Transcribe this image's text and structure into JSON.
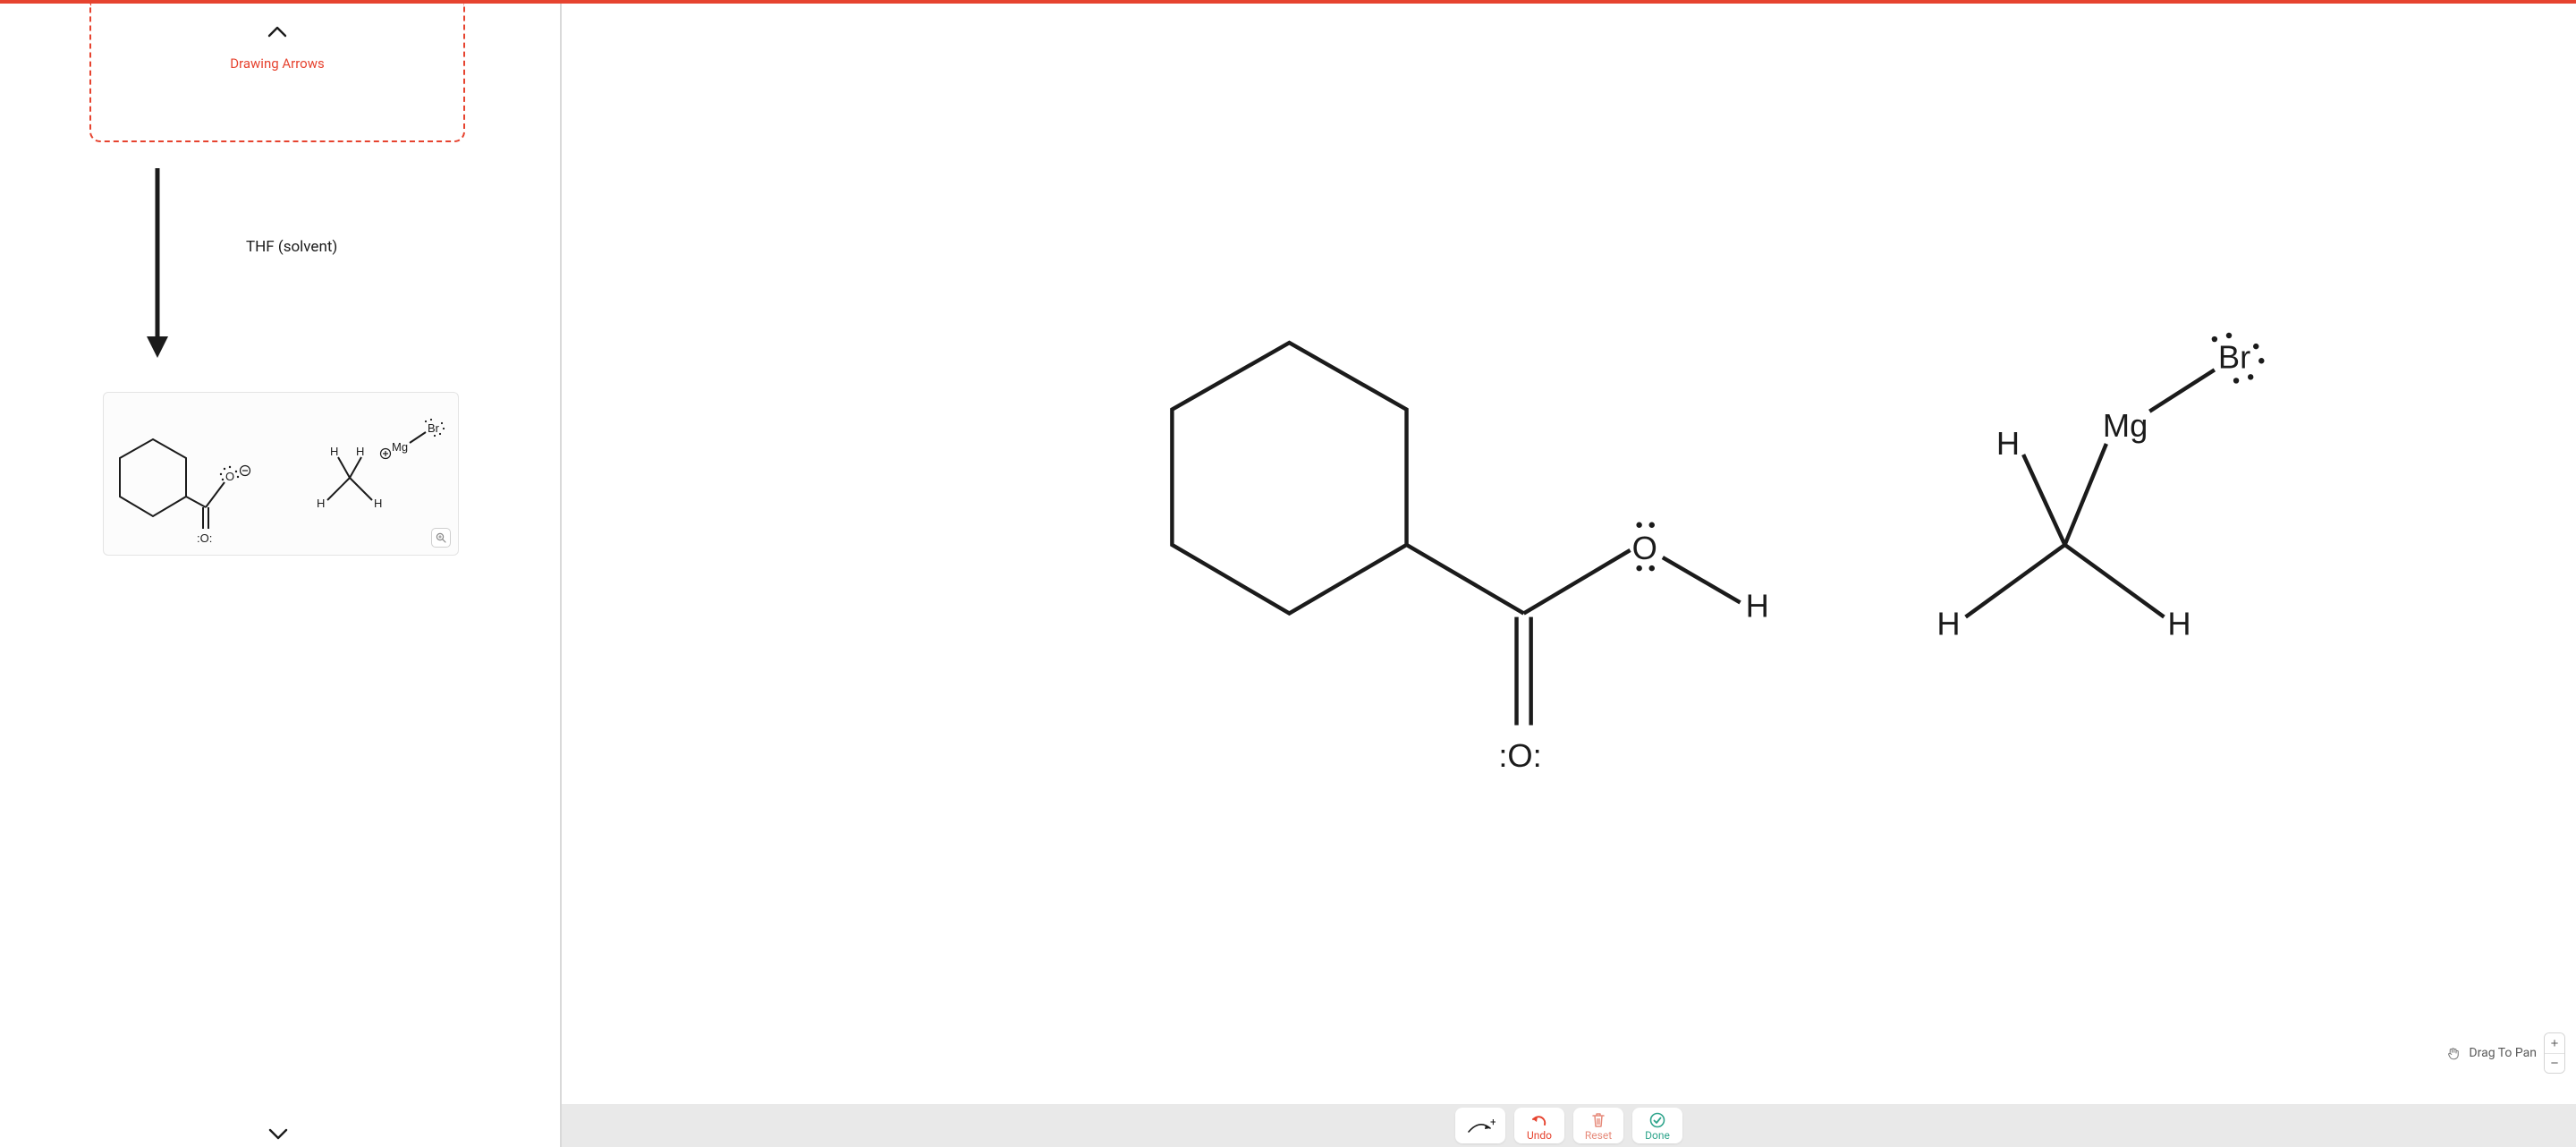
{
  "left": {
    "drawing_arrows_label": "Drawing Arrows",
    "solvent_label": "THF (solvent)",
    "structure_atoms": {
      "O_top": ":Ö:",
      "O_bottom": ":O:",
      "H1": "H",
      "H2": "H",
      "H3": "H",
      "H4": "H",
      "Mg": "Mg",
      "Br": "Br",
      "neg": "⊖",
      "pos": "⊕"
    }
  },
  "right": {
    "pan_label": "Drag To Pan",
    "toolbar": {
      "undo": "Undo",
      "reset": "Reset",
      "done": "Done"
    },
    "structure_atoms": {
      "O_top": "O",
      "O_bottom": ":O:",
      "H_oh": "H",
      "H1": "H",
      "H2": "H",
      "H3": "H",
      "Mg": "Mg",
      "Br": "Br"
    }
  }
}
